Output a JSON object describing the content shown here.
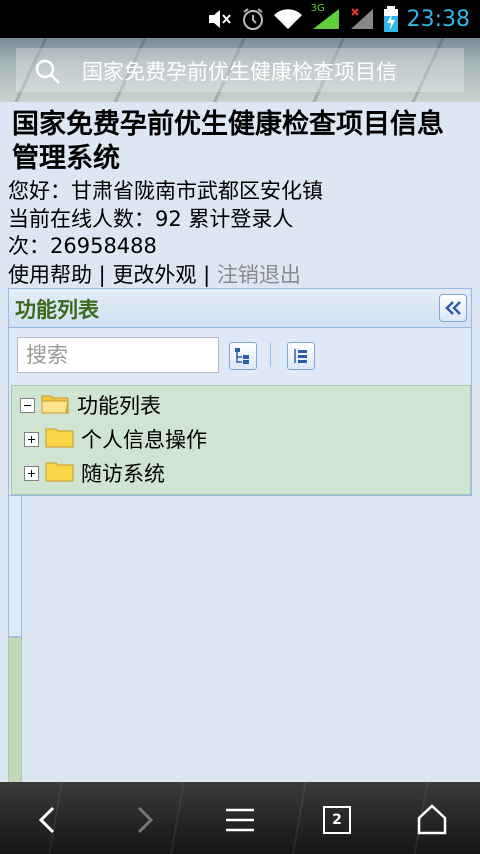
{
  "status_bar": {
    "time": "23:38",
    "network_label": "3G",
    "icons": [
      "mute-icon",
      "alarm-icon",
      "wifi-icon",
      "signal-icon",
      "signal-no-data-icon",
      "battery-charging-icon"
    ]
  },
  "browser": {
    "address_text": "国家免费孕前优生健康检查项目信",
    "tab_count": "2"
  },
  "page": {
    "title": "国家免费孕前优生健康检查项目信息管理系统",
    "greeting": "您好：甘肃省陇南市武都区安化镇",
    "online_line": "当前在线人数：92  累计登录人",
    "login_count_line": "次：26958488",
    "links": {
      "help": "使用帮助",
      "separator1": " | ",
      "change_theme": "更改外观",
      "separator2": " | ",
      "logout": "注销退出"
    }
  },
  "panel": {
    "title": "功能列表",
    "filter_placeholder": "搜索",
    "tree": [
      {
        "label": "功能列表",
        "expanded": true
      },
      {
        "label": "个人信息操作",
        "expanded": false
      },
      {
        "label": "随访系统",
        "expanded": false
      }
    ]
  },
  "colors": {
    "status_time": "#33b5e5",
    "panel_title": "#3a6a1c",
    "tree_bg": "#cfe5d1",
    "page_bg": "#dde6f3"
  }
}
